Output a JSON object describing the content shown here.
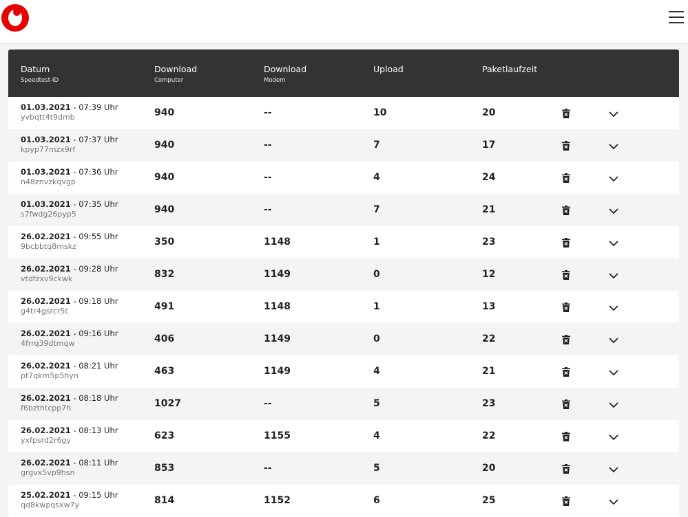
{
  "header": {
    "logo": "vodafone-logo",
    "menu_icon": "hamburger-menu-icon"
  },
  "table": {
    "columns": [
      {
        "label": "Datum",
        "sub": "Speedtest-ID"
      },
      {
        "label": "Download",
        "sub": "Computer"
      },
      {
        "label": "Download",
        "sub": "Modem"
      },
      {
        "label": "Upload",
        "sub": ""
      },
      {
        "label": "Paketlaufzeit",
        "sub": ""
      }
    ],
    "rows": [
      {
        "date": "01.03.2021",
        "time": "07:39 Uhr",
        "id": "yvbqtt4t9dmb",
        "dl_computer": "940",
        "dl_modem": "--",
        "upload": "10",
        "ping": "20"
      },
      {
        "date": "01.03.2021",
        "time": "07:37 Uhr",
        "id": "kpyp77mzx9rf",
        "dl_computer": "940",
        "dl_modem": "--",
        "upload": "7",
        "ping": "17"
      },
      {
        "date": "01.03.2021",
        "time": "07:36 Uhr",
        "id": "n48znvzkqvgp",
        "dl_computer": "940",
        "dl_modem": "--",
        "upload": "4",
        "ping": "24"
      },
      {
        "date": "01.03.2021",
        "time": "07:35 Uhr",
        "id": "s7fwdg26pyp5",
        "dl_computer": "940",
        "dl_modem": "--",
        "upload": "7",
        "ping": "21"
      },
      {
        "date": "26.02.2021",
        "time": "09:55 Uhr",
        "id": "9bcbbtq8mskz",
        "dl_computer": "350",
        "dl_modem": "1148",
        "upload": "1",
        "ping": "23"
      },
      {
        "date": "26.02.2021",
        "time": "09:28 Uhr",
        "id": "vtdfzxv9ckwk",
        "dl_computer": "832",
        "dl_modem": "1149",
        "upload": "0",
        "ping": "12"
      },
      {
        "date": "26.02.2021",
        "time": "09:18 Uhr",
        "id": "g4tr4gsrcr5t",
        "dl_computer": "491",
        "dl_modem": "1148",
        "upload": "1",
        "ping": "13"
      },
      {
        "date": "26.02.2021",
        "time": "09:16 Uhr",
        "id": "4frrq39dtmqw",
        "dl_computer": "406",
        "dl_modem": "1149",
        "upload": "0",
        "ping": "22"
      },
      {
        "date": "26.02.2021",
        "time": "08:21 Uhr",
        "id": "pt7qkm5p5hyn",
        "dl_computer": "463",
        "dl_modem": "1149",
        "upload": "4",
        "ping": "21"
      },
      {
        "date": "26.02.2021",
        "time": "08:18 Uhr",
        "id": "f6bzthtcpp7h",
        "dl_computer": "1027",
        "dl_modem": "--",
        "upload": "5",
        "ping": "23"
      },
      {
        "date": "26.02.2021",
        "time": "08:13 Uhr",
        "id": "yxfpsrd2r6gy",
        "dl_computer": "623",
        "dl_modem": "1155",
        "upload": "4",
        "ping": "22"
      },
      {
        "date": "26.02.2021",
        "time": "08:11 Uhr",
        "id": "grgvx5vp9hsn",
        "dl_computer": "853",
        "dl_modem": "--",
        "upload": "5",
        "ping": "20"
      },
      {
        "date": "25.02.2021",
        "time": "09:15 Uhr",
        "id": "qd8kwpqsxw7y",
        "dl_computer": "814",
        "dl_modem": "1152",
        "upload": "6",
        "ping": "25"
      }
    ],
    "row_actions": {
      "delete_icon": "trash-icon",
      "expand_icon": "chevron-down-icon"
    }
  },
  "colors": {
    "brand": "#e60000",
    "header_bg": "#333333",
    "row_alt": "#f4f4f4"
  }
}
